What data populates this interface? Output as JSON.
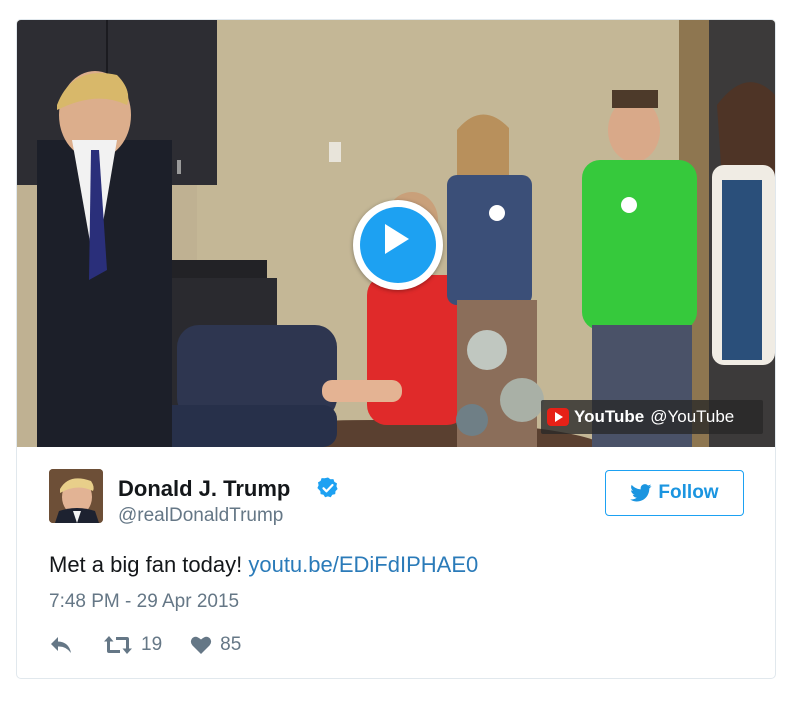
{
  "video": {
    "source_name": "YouTube",
    "source_handle": "@YouTube",
    "icons": {
      "play": "play-icon",
      "source": "youtube-logo-icon"
    }
  },
  "author": {
    "display_name": "Donald J. Trump",
    "handle": "@realDonaldTrump",
    "verified_icon": "verified-badge-icon"
  },
  "follow_button": {
    "label": "Follow",
    "icon": "twitter-bird-icon"
  },
  "tweet": {
    "text": "Met a big fan today! ",
    "link": "youtu.be/EDiFdIPHAE0",
    "timestamp": "7:48 PM - 29 Apr 2015"
  },
  "actions": {
    "reply_icon": "reply-icon",
    "retweet_icon": "retweet-icon",
    "retweet_count": "19",
    "like_icon": "heart-icon",
    "like_count": "85"
  },
  "colors": {
    "accent": "#1da1f2",
    "link": "#2b7bb9",
    "secondary_text": "#657786",
    "youtube_red": "#e62117"
  }
}
